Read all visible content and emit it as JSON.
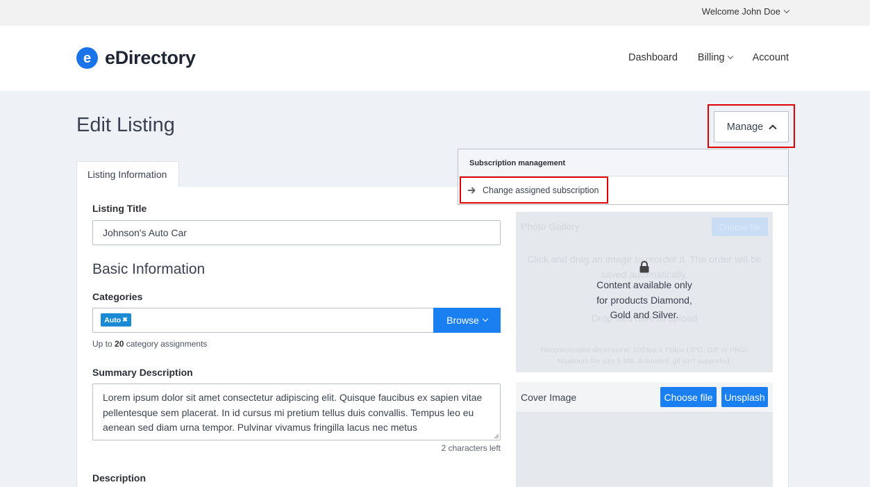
{
  "topbar": {
    "welcome": "Welcome John Doe"
  },
  "header": {
    "logo_mark": "e",
    "logo_text": "eDirectory",
    "nav": [
      {
        "label": "Dashboard"
      },
      {
        "label": "Billing"
      },
      {
        "label": "Account"
      }
    ]
  },
  "page": {
    "title": "Edit Listing"
  },
  "manage": {
    "label": "Manage",
    "dropdown_header": "Subscription management",
    "items": [
      {
        "label": "Change assigned subscription",
        "icon": "arrow-right-icon"
      }
    ]
  },
  "tabs": [
    {
      "label": "Listing Information"
    }
  ],
  "form": {
    "listing_title_label": "Listing Title",
    "listing_title_value": "Johnson's Auto Car",
    "basic_info_title": "Basic Information",
    "categories_label": "Categories",
    "category_tags": [
      {
        "label": "Auto"
      }
    ],
    "browse_label": "Browse",
    "category_limit_prefix": "Up to ",
    "category_limit_count": "20",
    "category_limit_suffix": " category assignments",
    "summary_label": "Summary Description",
    "summary_value": "Lorem ipsum dolor sit amet consectetur adipiscing elit. Quisque faucibus ex sapien vitae pellentesque sem placerat. In id cursus mi pretium tellus duis convallis. Tempus leo eu aenean sed diam urna tempor. Pulvinar vivamus fringilla lacus nec metus",
    "chars_left": "2 characters left",
    "description_label": "Description"
  },
  "gallery": {
    "title": "Photo Gallery",
    "choose_label": "Choose file",
    "drag_hint": "Click and drag an image to reorder it. The order will be saved automatically.",
    "drop_hint": "Drop files here to upload",
    "dimensions_hint": "Recommended dimensions: 1024px x 768px (JPG, GIF or PNG)",
    "size_hint": "Maximum file size 5 MB. Animated .gif isn't supported.",
    "locked_line1": "Content available only",
    "locked_line2": "for products Diamond,",
    "locked_line3": "Gold and Silver."
  },
  "cover": {
    "title": "Cover Image",
    "choose_label": "Choose file",
    "unsplash_label": "Unsplash"
  },
  "colors": {
    "primary": "#1a7ff0",
    "highlight": "#e00000",
    "tag": "#1a8ad4"
  }
}
